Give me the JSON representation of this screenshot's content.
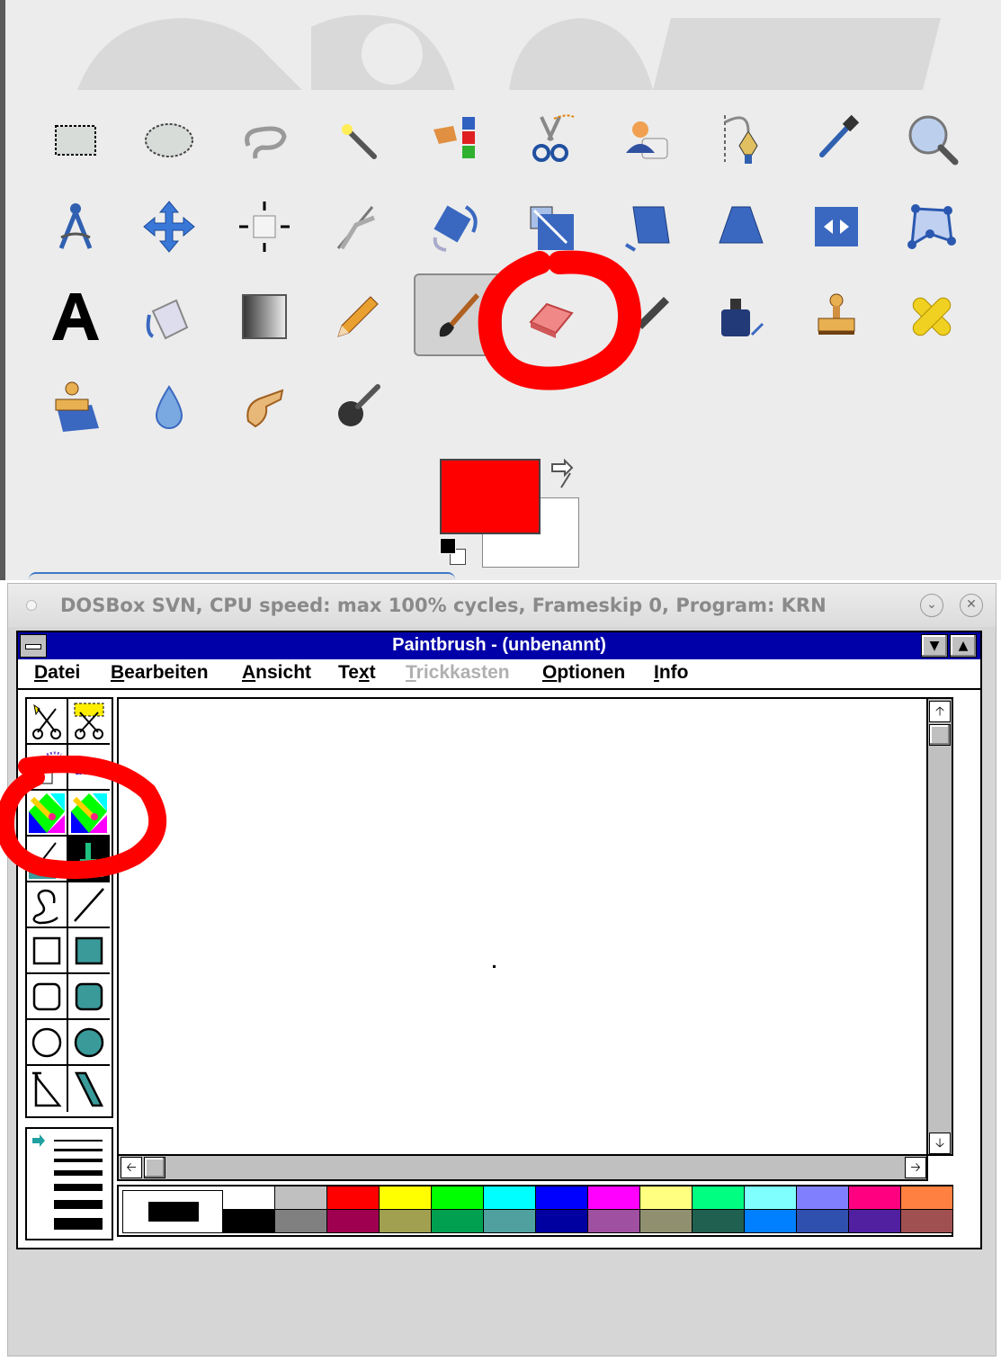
{
  "gimp": {
    "tools_row1": [
      "rect-select-icon",
      "ellipse-select-icon",
      "free-select-icon",
      "fuzzy-select-icon",
      "color-select-icon",
      "scissors-select-icon",
      "foreground-select-icon",
      "paths-icon",
      "color-picker-icon",
      "zoom-icon"
    ],
    "tools_row2": [
      "measure-icon",
      "move-icon",
      "align-icon",
      "crop-icon",
      "rotate-icon",
      "scale-icon",
      "shear-icon",
      "perspective-icon",
      "flip-icon",
      "cage-transform-icon"
    ],
    "tools_row3": [
      "text-icon",
      "bucket-fill-icon",
      "blend-icon",
      "pencil-icon",
      "paintbrush-icon",
      "eraser-icon",
      "airbrush-icon",
      "ink-icon",
      "clone-icon",
      "heal-icon"
    ],
    "tools_row4": [
      "perspective-clone-icon",
      "blur-icon",
      "smudge-icon",
      "dodge-burn-icon"
    ],
    "active_tool": "paintbrush-icon",
    "highlighted_tool": "eraser-icon",
    "foreground_color": "#ff0000",
    "background_color": "#ffffff"
  },
  "dosbox": {
    "title": "DOSBox SVN, CPU speed: max 100% cycles, Frameskip  0, Program:  KRN"
  },
  "paintbrush": {
    "title": "Paintbrush - (unbenannt)",
    "menus": [
      {
        "label": "Datei",
        "underline": "D",
        "rest": "atei",
        "disabled": false
      },
      {
        "label": "Bearbeiten",
        "underline": "B",
        "rest": "earbeiten",
        "disabled": false
      },
      {
        "label": "Ansicht",
        "underline": "A",
        "rest": "nsicht",
        "disabled": false
      },
      {
        "label": "Text",
        "pre": "Te",
        "underline": "x",
        "rest": "t",
        "disabled": false
      },
      {
        "label": "Trickkasten",
        "underline": "T",
        "rest": "rickkasten",
        "disabled": true
      },
      {
        "label": "Optionen",
        "underline": "O",
        "rest": "ptionen",
        "disabled": false
      },
      {
        "label": "Info",
        "underline": "I",
        "rest": "nfo",
        "disabled": false
      }
    ],
    "tools": [
      "scissors-icon",
      "pick-icon",
      "airbrush-icon",
      "text-abc-icon",
      "color-eraser-icon",
      "eraser-icon",
      "paint-roller-icon",
      "brush-icon",
      "curve-icon",
      "line-icon",
      "box-icon",
      "filled-box-icon",
      "rounded-box-icon",
      "filled-rounded-box-icon",
      "circle-icon",
      "filled-circle-icon",
      "polygon-icon",
      "filled-polygon-icon"
    ],
    "current_color": "#000000",
    "palette_top": [
      "#ffffff",
      "#c0c0c0",
      "#ff0000",
      "#ffff00",
      "#00ff00",
      "#00ffff",
      "#0000ff",
      "#ff00ff",
      "#ffff80",
      "#00ff80",
      "#80ffff",
      "#8080ff",
      "#ff0080",
      "#ff8040"
    ],
    "palette_bottom": [
      "#000000",
      "#808080",
      "#a00050",
      "#a0a050",
      "#00a050",
      "#50a0a0",
      "#0000a0",
      "#a050a0",
      "#909070",
      "#206050",
      "#0080ff",
      "#3050b0",
      "#5020a0",
      "#a05050"
    ]
  }
}
